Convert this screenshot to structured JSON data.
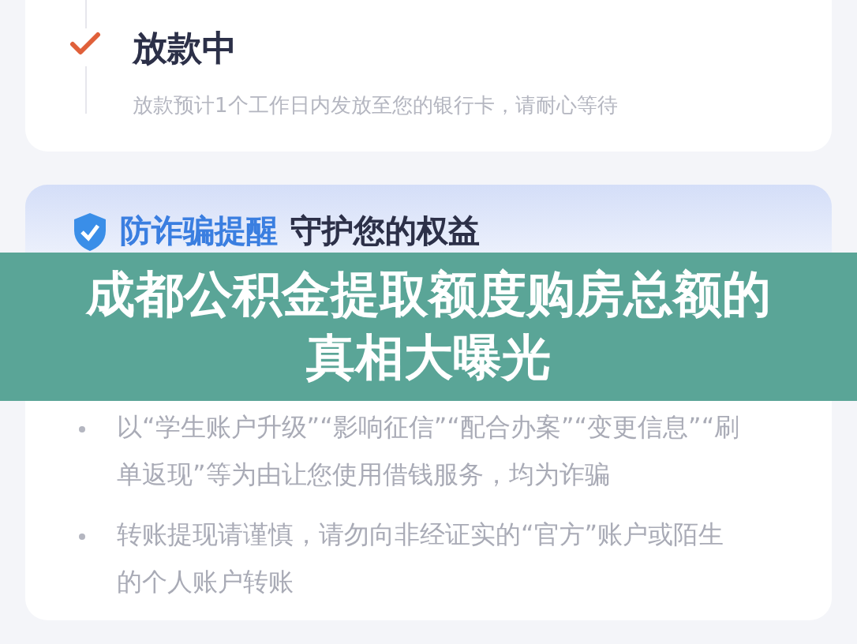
{
  "step": {
    "title": "放款中",
    "description": "放款预计1个工作日内发放至您的银行卡，请耐心等待",
    "done": true
  },
  "notice": {
    "title_highlight": "防诈骗提醒",
    "title_rest": "守护您的权益",
    "items": [
      "以“学生账户升级”“影响征信”“配合办案”“变更信息”“刷单返现”等为由让您使用借钱服务，均为诈骗",
      "转账提现请谨慎，请勿向非经证实的“官方”账户或陌生的个人账户转账"
    ]
  },
  "banner": {
    "title": "成都公积金提取额度购房总额的真相大曝光"
  }
}
